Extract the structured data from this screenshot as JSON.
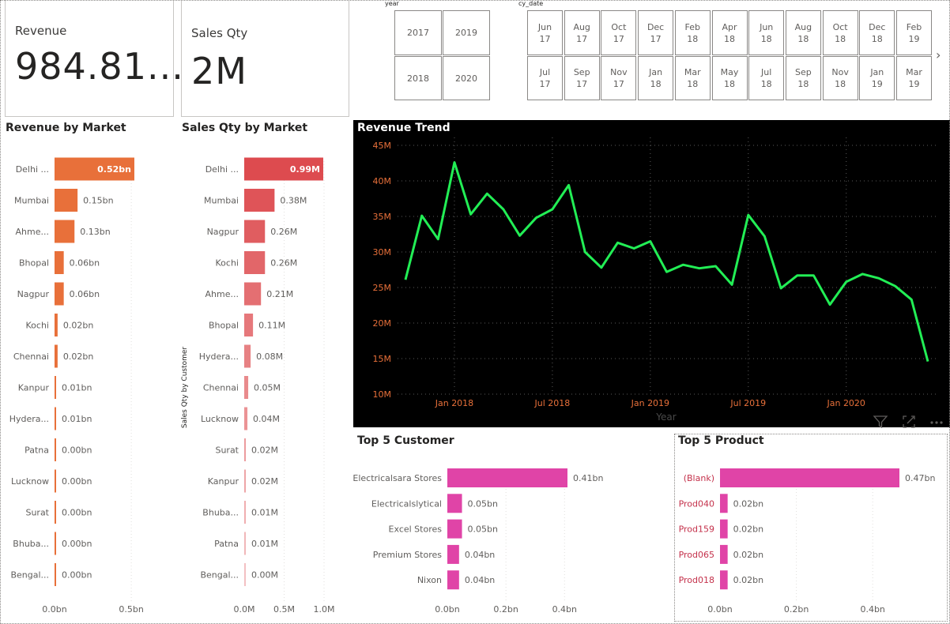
{
  "cards": {
    "revenue": {
      "label": "Revenue",
      "value": "984.81..."
    },
    "sales_qty": {
      "label": "Sales Qty",
      "value": "2M"
    }
  },
  "year_slicer": {
    "title": "year",
    "items": [
      "2017",
      "2019",
      "2018",
      "2020"
    ]
  },
  "date_slicer": {
    "title": "cy_date",
    "row1": [
      "Jun\n17",
      "Aug\n17",
      "Oct\n17",
      "Dec\n17",
      "Feb\n18",
      "Apr\n18",
      "Jun\n18",
      "Aug\n18",
      "Oct\n18",
      "Dec\n18",
      "Feb\n19"
    ],
    "row2": [
      "Jul\n17",
      "Sep\n17",
      "Nov\n17",
      "Jan\n18",
      "Mar\n18",
      "May\n18",
      "Jul\n18",
      "Sep\n18",
      "Nov\n18",
      "Jan\n19",
      "Mar\n19"
    ],
    "next_icon": "chevron-right-icon"
  },
  "visual_header_icons": [
    "filter-icon",
    "focus-mode-icon",
    "more-options-icon"
  ],
  "chart_data": [
    {
      "id": "revenue_by_market",
      "type": "bar",
      "title": "Revenue by Market",
      "categories": [
        "Delhi ...",
        "Mumbai",
        "Ahme...",
        "Bhopal",
        "Nagpur",
        "Kochi",
        "Chennai",
        "Kanpur",
        "Hydera...",
        "Patna",
        "Lucknow",
        "Surat",
        "Bhuba...",
        "Bengal..."
      ],
      "values": [
        0.52,
        0.15,
        0.13,
        0.06,
        0.06,
        0.02,
        0.02,
        0.01,
        0.01,
        0.0,
        0.0,
        0.0,
        0.0,
        0.0
      ],
      "data_labels": [
        "0.52bn",
        "0.15bn",
        "0.13bn",
        "0.06bn",
        "0.06bn",
        "0.02bn",
        "0.02bn",
        "0.01bn",
        "0.01bn",
        "0.00bn",
        "0.00bn",
        "0.00bn",
        "0.00bn",
        "0.00bn"
      ],
      "xticks": [
        "0.0bn",
        "0.5bn"
      ],
      "xtick_values": [
        0,
        0.5
      ],
      "xlim": [
        0,
        0.52
      ],
      "color": "#e8703a",
      "highlight_label_color": "#ffffff"
    },
    {
      "id": "sales_qty_by_market",
      "type": "bar",
      "title": "Sales Qty by Market",
      "ylabel": "Sales Qty by Customer",
      "categories": [
        "Delhi ...",
        "Mumbai",
        "Nagpur",
        "Kochi",
        "Ahme...",
        "Bhopal",
        "Hydera...",
        "Chennai",
        "Lucknow",
        "Surat",
        "Kanpur",
        "Bhuba...",
        "Patna",
        "Bengal..."
      ],
      "values": [
        0.99,
        0.38,
        0.26,
        0.26,
        0.21,
        0.11,
        0.08,
        0.05,
        0.04,
        0.02,
        0.02,
        0.01,
        0.01,
        0.0
      ],
      "data_labels": [
        "0.99M",
        "0.38M",
        "0.26M",
        "0.26M",
        "0.21M",
        "0.11M",
        "0.08M",
        "0.05M",
        "0.04M",
        "0.02M",
        "0.02M",
        "0.01M",
        "0.01M",
        "0.00M"
      ],
      "xticks": [
        "0.0M",
        "0.5M",
        "1.0M"
      ],
      "xtick_values": [
        0,
        0.5,
        1.0
      ],
      "xlim": [
        0,
        1.0
      ],
      "color": "#dd4b4f",
      "highlight_label_color": "#ffffff"
    },
    {
      "id": "revenue_trend",
      "type": "line",
      "title": "Revenue Trend",
      "xlabel": "Year",
      "x": [
        "2017-06",
        "2017-07",
        "2017-08",
        "2017-09",
        "2017-10",
        "2017-11",
        "2017-12",
        "2018-01",
        "2018-02",
        "2018-03",
        "2018-04",
        "2018-05",
        "2018-06",
        "2018-07",
        "2018-08",
        "2018-09",
        "2018-10",
        "2018-11",
        "2018-12",
        "2019-01",
        "2019-02",
        "2019-03",
        "2019-04",
        "2019-05",
        "2019-06",
        "2019-07",
        "2019-08",
        "2019-09",
        "2019-10",
        "2019-11",
        "2019-12",
        "2020-01",
        "2020-02",
        "2020-03",
        "2020-04",
        "2020-05",
        "2020-06"
      ],
      "values": [
        26.1,
        35.1,
        31.8,
        42.6,
        35.3,
        38.2,
        36.0,
        32.3,
        34.8,
        36.0,
        39.4,
        30.0,
        27.8,
        31.3,
        30.5,
        31.5,
        27.2,
        28.2,
        27.7,
        28.0,
        25.4,
        35.2,
        32.2,
        24.9,
        26.7,
        26.7,
        22.6,
        25.8,
        26.9,
        26.3,
        25.2,
        23.3,
        14.6
      ],
      "yticks": [
        "45M",
        "40M",
        "35M",
        "30M",
        "25M",
        "20M",
        "15M",
        "10M"
      ],
      "ytick_values": [
        45,
        40,
        35,
        30,
        25,
        20,
        15,
        10
      ],
      "ylim": [
        10,
        45
      ],
      "xticks": [
        "Jan 2018",
        "Jul 2018",
        "Jan 2019",
        "Jul 2019",
        "Jan 2020"
      ],
      "xtick_index": [
        3,
        9,
        15,
        21,
        27
      ],
      "grid": true,
      "background": "#000000",
      "line_color": "#22ee55",
      "tick_color": "#e8703a"
    },
    {
      "id": "top5_customer",
      "type": "bar",
      "title": "Top 5 Customer",
      "categories": [
        "Electricalsara Stores",
        "Electricalslytical",
        "Excel Stores",
        "Premium Stores",
        "Nixon"
      ],
      "values": [
        0.41,
        0.05,
        0.05,
        0.04,
        0.04
      ],
      "data_labels": [
        "0.41bn",
        "0.05bn",
        "0.05bn",
        "0.04bn",
        "0.04bn"
      ],
      "xticks": [
        "0.0bn",
        "0.2bn",
        "0.4bn"
      ],
      "xtick_values": [
        0,
        0.2,
        0.4
      ],
      "xlim": [
        0,
        0.41
      ],
      "color": "#e044a7"
    },
    {
      "id": "top5_product",
      "type": "bar",
      "title": "Top 5 Product",
      "categories": [
        "(Blank)",
        "Prod040",
        "Prod159",
        "Prod065",
        "Prod018"
      ],
      "values": [
        0.47,
        0.02,
        0.02,
        0.02,
        0.02
      ],
      "data_labels": [
        "0.47bn",
        "0.02bn",
        "0.02bn",
        "0.02bn",
        "0.02bn"
      ],
      "xticks": [
        "0.0bn",
        "0.2bn",
        "0.4bn"
      ],
      "xtick_values": [
        0,
        0.2,
        0.4
      ],
      "xlim": [
        0,
        0.47
      ],
      "color": "#e044a7",
      "category_color": "#c4314b"
    }
  ]
}
